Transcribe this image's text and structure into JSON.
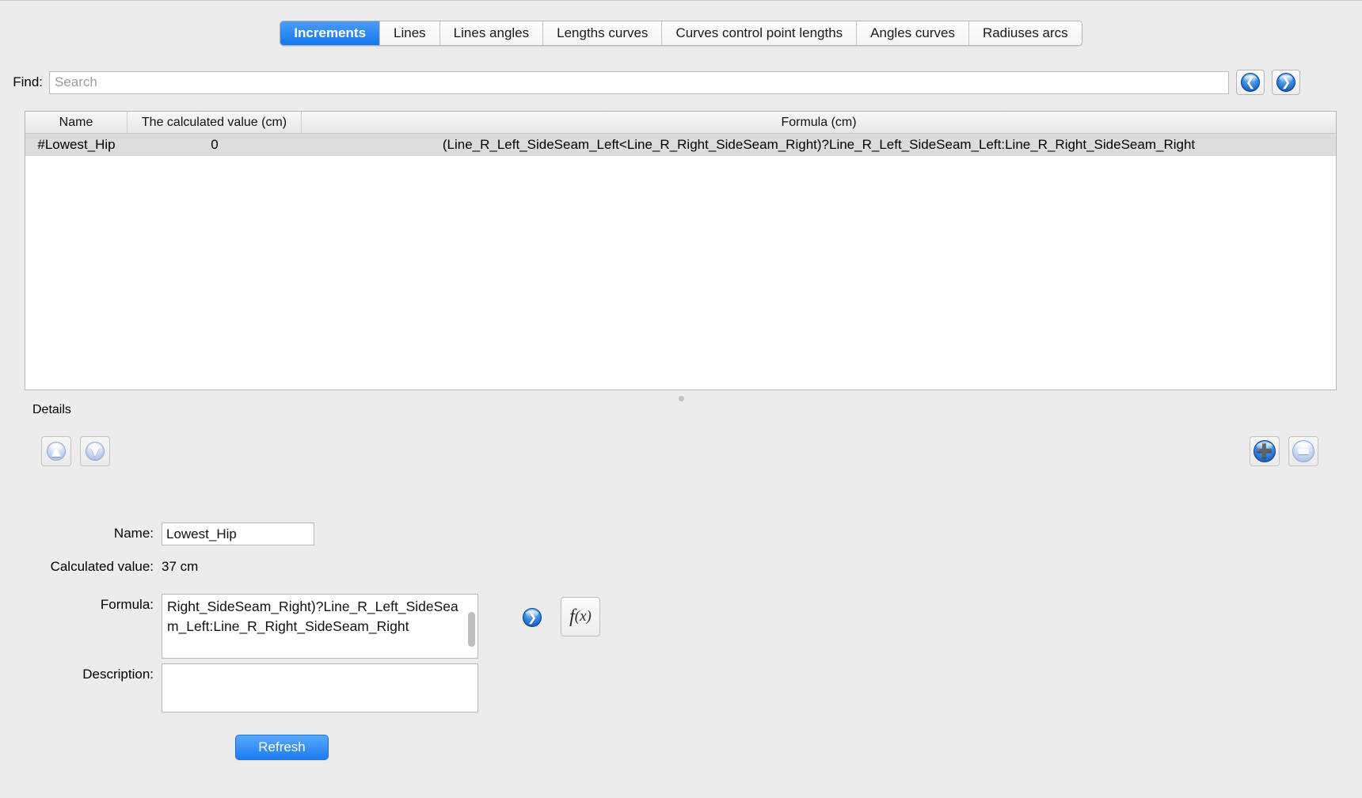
{
  "tabs": [
    {
      "label": "Increments",
      "active": true
    },
    {
      "label": "Lines",
      "active": false
    },
    {
      "label": "Lines angles",
      "active": false
    },
    {
      "label": "Lengths curves",
      "active": false
    },
    {
      "label": "Curves control point lengths",
      "active": false
    },
    {
      "label": "Angles curves",
      "active": false
    },
    {
      "label": "Radiuses arcs",
      "active": false
    }
  ],
  "find": {
    "label": "Find:",
    "value": "",
    "placeholder": "Search",
    "prev_icon": "arrow-left-icon",
    "next_icon": "arrow-right-icon"
  },
  "table": {
    "columns": [
      "Name",
      "The calculated value (cm)",
      "Formula (cm)"
    ],
    "rows": [
      {
        "name": "#Lowest_Hip",
        "calculated_value": "0",
        "formula": "(Line_R_Left_SideSeam_Left<Line_R_Right_SideSeam_Right)?Line_R_Left_SideSeam_Left:Line_R_Right_SideSeam_Right",
        "selected": true
      }
    ]
  },
  "details": {
    "title": "Details",
    "move_up_icon": "arrow-up-icon",
    "move_down_icon": "arrow-down-icon",
    "add_icon": "plus-icon",
    "remove_icon": "minus-icon",
    "name_label": "Name:",
    "name_value": "Lowest_Hip",
    "calculated_label": "Calculated value:",
    "calculated_value": "37 cm",
    "formula_label": "Formula:",
    "formula_value": "Right_SideSeam_Right)?Line_R_Left_SideSeam_Left:Line_R_Right_SideSeam_Right",
    "formula_push_icon": "arrow-right-icon",
    "fx_label_f": "f",
    "fx_label_x": "(x)",
    "description_label": "Description:",
    "description_value": "",
    "refresh_label": "Refresh"
  },
  "colors": {
    "accent": "#1a7cf2",
    "window_bg": "#ececec",
    "row_selected": "#dcdcdc"
  }
}
